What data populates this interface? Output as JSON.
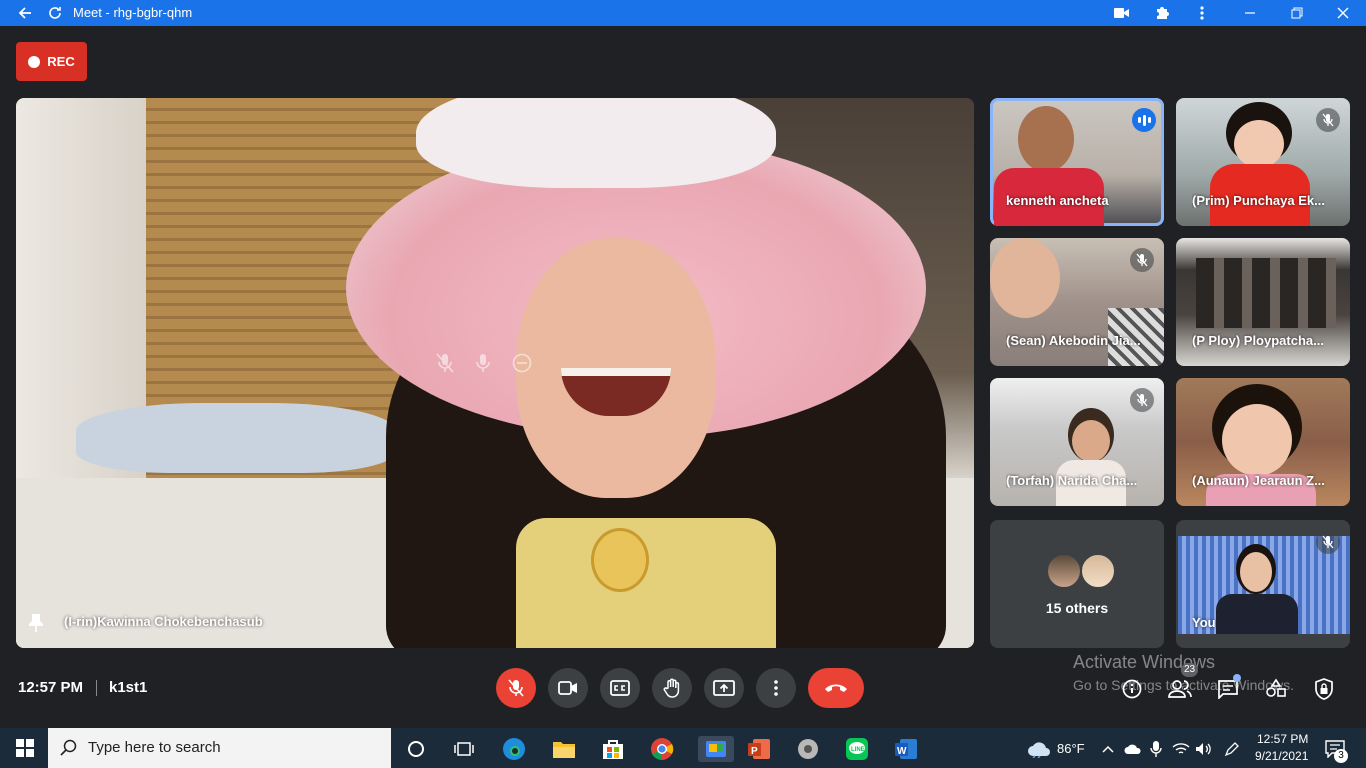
{
  "window": {
    "title": "Meet - rhg-bgbr-qhm",
    "accent": "#1a73e8"
  },
  "rec_label": "REC",
  "main": {
    "name": "(I-rin)Kawinna Chokebenchasub"
  },
  "tiles": [
    {
      "name": "kenneth ancheta",
      "state": "speaking"
    },
    {
      "name": "(Prim) Punchaya Ek...",
      "state": "muted"
    },
    {
      "name": "(Sean) Akebodin Jia...",
      "state": "muted"
    },
    {
      "name": "(P Ploy) Ploypatcha...",
      "state": "none"
    },
    {
      "name": "(Torfah) Narida Cha...",
      "state": "muted"
    },
    {
      "name": "(Aunaun) Jearaun Z...",
      "state": "none"
    }
  ],
  "others": {
    "label": "15 others"
  },
  "self": {
    "name": "You"
  },
  "bottom": {
    "time": "12:57 PM",
    "meeting_code": "k1st1",
    "participants_badge": "23"
  },
  "watermark": {
    "line1": "Activate Windows",
    "line2": "Go to Settings to activate Windows."
  },
  "taskbar": {
    "search_placeholder": "Type here to search",
    "weather": "86°F",
    "time": "12:57 PM",
    "date": "9/21/2021",
    "notifications": "3"
  },
  "colors": {
    "danger": "#ea4335",
    "background": "#202124",
    "tile": "#3c4043"
  }
}
